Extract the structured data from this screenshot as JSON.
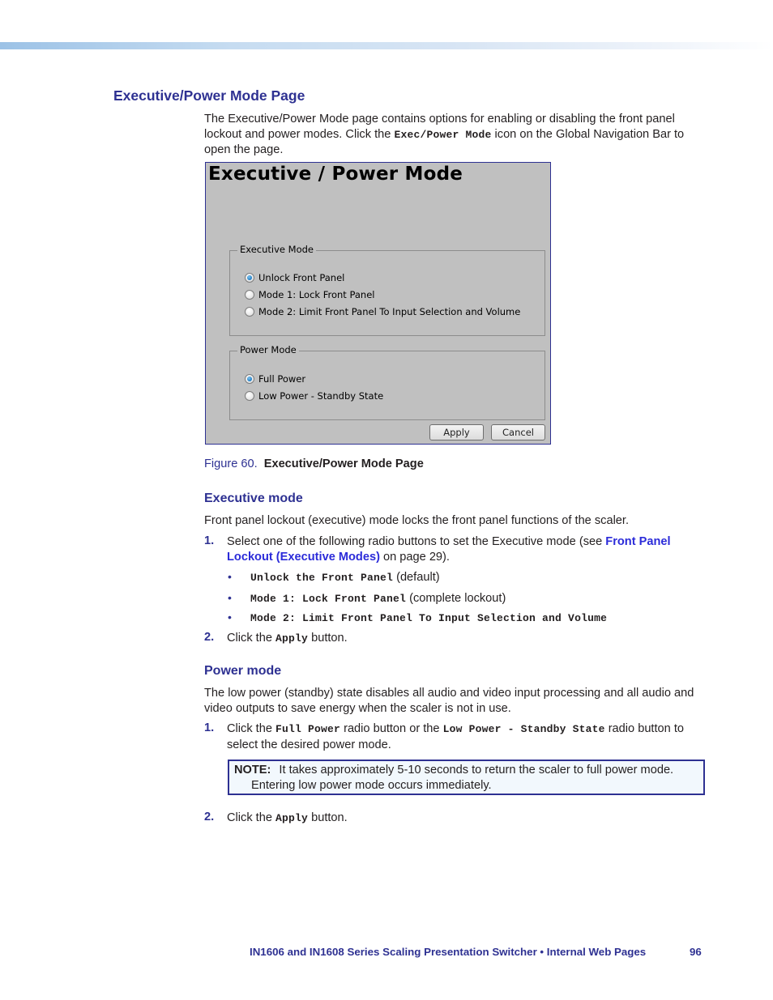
{
  "section": {
    "title": "Executive/Power Mode Page",
    "intro_part1": "The Executive/Power Mode page contains options for enabling or disabling the front panel lockout and power modes. Click the ",
    "intro_code": "Exec/Power Mode",
    "intro_part2": " icon on the Global Navigation Bar to open the page."
  },
  "figure": {
    "screen_title": "Executive / Power Mode",
    "executive_group": {
      "legend": "Executive Mode",
      "options": [
        {
          "label": "Unlock Front Panel",
          "checked": true
        },
        {
          "label": "Mode 1: Lock Front Panel",
          "checked": false
        },
        {
          "label": "Mode 2: Limit Front Panel To Input Selection and Volume",
          "checked": false
        }
      ]
    },
    "power_group": {
      "legend": "Power Mode",
      "options": [
        {
          "label": "Full Power",
          "checked": true
        },
        {
          "label": "Low Power - Standby State",
          "checked": false
        }
      ]
    },
    "apply_label": "Apply",
    "cancel_label": "Cancel",
    "caption_number": "Figure 60.",
    "caption_title": "Executive/Power Mode Page"
  },
  "executive_mode": {
    "heading": "Executive mode",
    "description": "Front panel lockout (executive) mode locks the front panel functions of the scaler.",
    "step1_num": "1.",
    "step1_part1": "Select one of the following radio buttons to set the Executive mode (see ",
    "step1_link": "Front Panel Lockout (Executive Modes)",
    "step1_part2": " on page 29).",
    "bullets": [
      {
        "code": "Unlock the Front Panel",
        "note": " (default)"
      },
      {
        "code": "Mode 1: Lock Front Panel",
        "note": " (complete lockout)"
      },
      {
        "code": "Mode 2: Limit Front Panel To Input Selection and Volume",
        "note": ""
      }
    ],
    "bullet_glyph": "•",
    "step2_num": "2.",
    "step2_part1": "Click the ",
    "step2_code": "Apply",
    "step2_part2": " button."
  },
  "power_mode": {
    "heading": "Power mode",
    "description": "The low power (standby) state disables all audio and video input processing and all audio and video outputs to save energy when the scaler is not in use.",
    "step1_num": "1.",
    "step1_part1": "Click the ",
    "step1_code1": "Full Power",
    "step1_part2": " radio button or the ",
    "step1_code2": "Low Power - Standby State",
    "step1_part3": " radio button to select the desired power mode.",
    "note_label": "NOTE:",
    "note_line1": "It takes approximately 5-10 seconds to return the scaler to full power mode.",
    "note_line2": "Entering low power mode occurs immediately.",
    "step2_num": "2.",
    "step2_part1": "Click the ",
    "step2_code": "Apply",
    "step2_part2": " button."
  },
  "footer": {
    "text": "IN1606 and IN1608 Series Scaling Presentation Switcher • Internal Web Pages",
    "page": "96"
  }
}
